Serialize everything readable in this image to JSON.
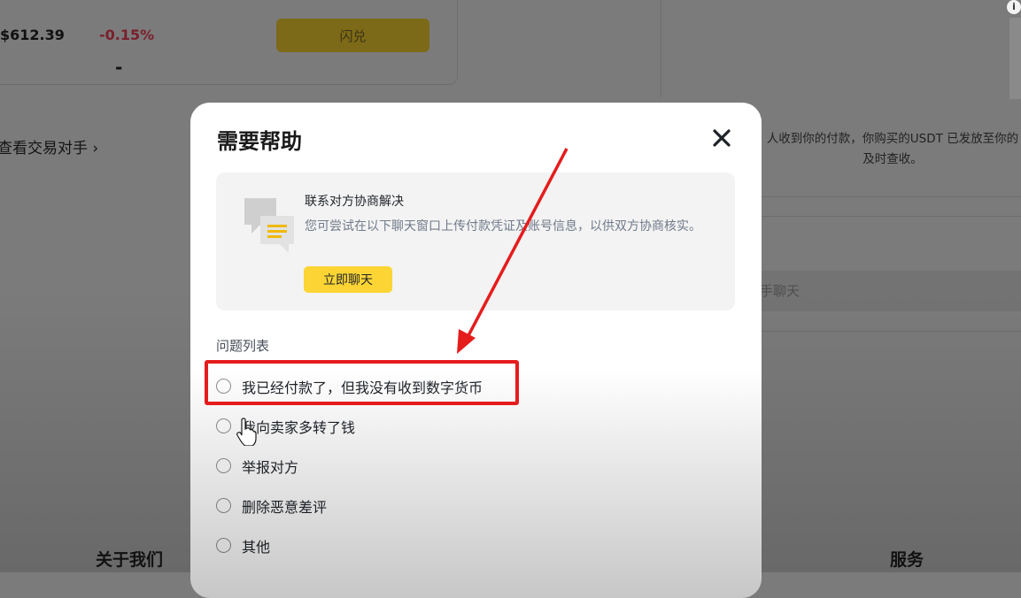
{
  "background": {
    "price": "$612.39",
    "change": "-0.15%",
    "dash": "-",
    "swap_button": "闪兑",
    "counterparty_link": "查看交易对手  ›",
    "notice": "人收到你的付款，你购买的USDT 已发放至你的\n及时查收。",
    "chat_placeholder": "手聊天",
    "footer_about": "关于我们",
    "footer_service": "服务",
    "info_icon": "i"
  },
  "modal": {
    "title": "需要帮助",
    "close_icon": "close-icon",
    "contact": {
      "title": "联系对方协商解决",
      "description": "您可尝试在以下聊天窗口上传付款凭证及账号信息，以供双方协商核实。",
      "button": "立即聊天"
    },
    "problem_list_title": "问题列表",
    "options": [
      {
        "label": "我已经付款了，但我没有收到数字货币",
        "selected": false
      },
      {
        "label": "我向卖家多转了钱",
        "selected": false
      },
      {
        "label": "举报对方",
        "selected": false
      },
      {
        "label": "删除恶意差评",
        "selected": false
      },
      {
        "label": "其他",
        "selected": false
      }
    ]
  },
  "colors": {
    "accent_yellow": "#fcd535",
    "annotation_red": "#e51c1c",
    "negative_change": "#7a1f2c"
  }
}
